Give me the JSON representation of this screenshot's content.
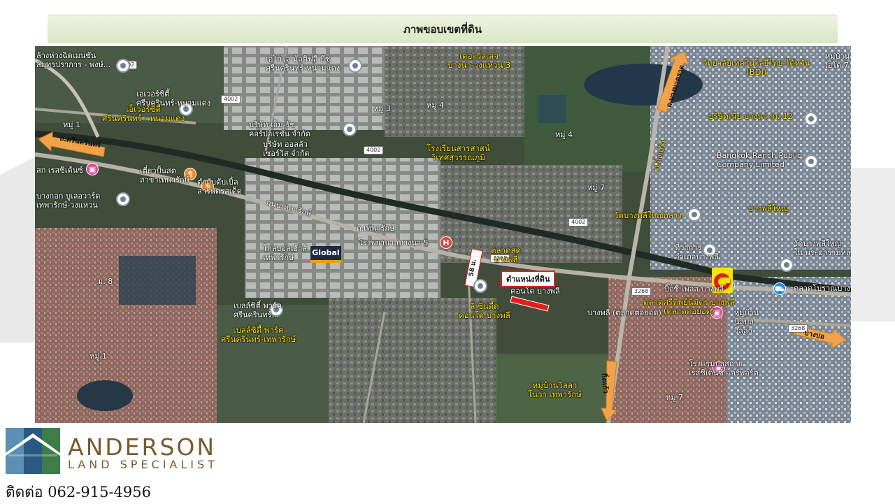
{
  "header": {
    "title": "ภาพขอบเขตที่ดิน"
  },
  "map": {
    "labels": [
      {
        "id": "l1",
        "text": "ล้างห่วงฉิดเมนชัน\nสมุทรปราการ - พงษ์...",
        "cls": "w"
      },
      {
        "id": "l2",
        "text": "เอโกไล มัลติฟลี บีช\nศรีนครินทร์-หนามแดง",
        "cls": "w"
      },
      {
        "id": "l3",
        "text": "เดอะวิลเลจ\nบางนา-วงแหวน 3",
        "cls": "y c"
      },
      {
        "id": "l4",
        "text": "หมู่บ้าน\nเอโด 7",
        "cls": "w"
      },
      {
        "id": "l5",
        "text": "วิทยาลัยเทคโนโลยีไทย-ไต้หวัน\n(BDI)",
        "cls": "y c"
      },
      {
        "id": "l6",
        "text": "เอเวอร์ซิตี้\nศรีนครินทร์-หนามแดง",
        "cls": "w"
      },
      {
        "id": "l7",
        "text": "เอ็เวอร์ซิตี้\nศรีนครินทร์ - หนามแดง",
        "cls": "y c"
      },
      {
        "id": "l8",
        "text": "หมู่ 3",
        "cls": "w"
      },
      {
        "id": "l9",
        "text": "หมู่ 4",
        "cls": "w"
      },
      {
        "id": "l10",
        "text": "หมู่ 4",
        "cls": "w"
      },
      {
        "id": "l11",
        "text": "บริษัท เอ็ม-รัช\nคอร์ปอเรชั่น จำกัด",
        "cls": "w"
      },
      {
        "id": "l12",
        "text": "บริษัท ออลลัว\nเซอร์วิส จำกัด",
        "cls": "w"
      },
      {
        "id": "l13",
        "text": "บริษัทเนีย บางนา กม.12",
        "cls": "y"
      },
      {
        "id": "l14",
        "text": "หมู่ 1",
        "cls": "w"
      },
      {
        "id": "l15",
        "text": "โรงเรียนสารสาสน์\nวิเทศสุวรรณภูมิ",
        "cls": "y c"
      },
      {
        "id": "l16",
        "text": "Bangkok Ranch Public\nCompany Limited",
        "cls": "w"
      },
      {
        "id": "l17",
        "text": "สก เรสซิเด้นซ์",
        "cls": "w"
      },
      {
        "id": "l18",
        "text": "เตี๋ยวปั้นสด\nสาขาเทพารักษ์",
        "cls": "w"
      },
      {
        "id": "l19",
        "text": "ตำกับดับเบิ้ล\nสารพัดรสเด็ด",
        "cls": "w"
      },
      {
        "id": "l20",
        "text": "หมู่ 7",
        "cls": "w"
      },
      {
        "id": "l21",
        "text": "บางกอก บูเลอวาร์ด\nเทพารักษ์-วงแหวน",
        "cls": "w"
      },
      {
        "id": "l22",
        "text": "ถนนเทพารักษ์",
        "cls": "w"
      },
      {
        "id": "l23",
        "text": "วัดบางพลีใหญ่กลาง",
        "cls": "y"
      },
      {
        "id": "l24",
        "text": "บางพลีใหญ่",
        "cls": "y"
      },
      {
        "id": "l25",
        "text": "ถ.เทพารักษ์",
        "cls": "w"
      },
      {
        "id": "l26",
        "text": "โรงพยาบาลบางนา 5",
        "cls": "w"
      },
      {
        "id": "l27",
        "text": "โกลบอลเฮ้าส์\nเทพารักษ์",
        "cls": "w"
      },
      {
        "id": "l28",
        "text": "ตลาดสด\nบางพลี",
        "cls": "y c"
      },
      {
        "id": "l29",
        "text": "ที่ว่าการ\nอำเภอบางพลี",
        "cls": "w"
      },
      {
        "id": "l30",
        "text": "วัดบางพลีใหญ่\nใน พระอารามหลวง",
        "cls": "w"
      },
      {
        "id": "l31",
        "text": "ม. 8",
        "cls": "w"
      },
      {
        "id": "l32",
        "text": "คอนโด บางพลี",
        "cls": "w"
      },
      {
        "id": "l33",
        "text": "บิ๊กซี เพลส บางพลี",
        "cls": "w"
      },
      {
        "id": "l34",
        "text": "ตลาดโบราณบางพลี",
        "cls": "w"
      },
      {
        "id": "l35",
        "text": "ลิ ซิ่นดี้ด\nคอนโด บางพลี",
        "cls": "y c"
      },
      {
        "id": "l36",
        "text": "ตลาดศรีทิพย์นิมิตร บางพลี\n(ตลาดต่อยอด)",
        "cls": "y c"
      },
      {
        "id": "l37",
        "text": "บางพลี (ตลาดต่อยอด)",
        "cls": "w"
      },
      {
        "id": "l38",
        "text": "เบลล์ซิตี้ พาร์ค\nศรีนครินทร์...",
        "cls": "w"
      },
      {
        "id": "l39",
        "text": "เบลล์ซิตี้ พาร์ค\nศรีนครินทร์-เทพารักษ์",
        "cls": "y c"
      },
      {
        "id": "l40",
        "text": "หมู่บ้าน\nนิลุบล\nวิลล่า",
        "cls": "w"
      },
      {
        "id": "l41",
        "text": "หมู่ 1",
        "cls": "w"
      },
      {
        "id": "l42",
        "text": "โรงแรมบลูสกาย\nเรสซิเดนซ์ แอร์พอร์ต",
        "cls": "w"
      },
      {
        "id": "l43",
        "text": "หมู่บ้านวิลลา\nโนวา เทพารักษ์",
        "cls": "y c"
      },
      {
        "id": "l44",
        "text": "หมู่ 7",
        "cls": "w"
      },
      {
        "id": "l45",
        "text": "ถ.กิ่งแก้ว",
        "cls": "y"
      }
    ],
    "roads": {
      "route_a": "4002",
      "route_b": "3268",
      "srinakarin": "ถ.ศรีนครินทร์",
      "bang_na_trat": "ถ.บางนาตราด",
      "bang_bo": "บางบ่อ",
      "kingkaew_south": "กิ่งแก้ว",
      "site_dim": "58 ม."
    },
    "site": {
      "label": "ตำแหน่งที่ดิน"
    },
    "brands": {
      "global": "Global"
    }
  },
  "branding": {
    "company": "ANDERSON",
    "tagline": "LAND SPECIALIST"
  },
  "contact": {
    "text": "ติดต่อ 062-915-4956"
  }
}
